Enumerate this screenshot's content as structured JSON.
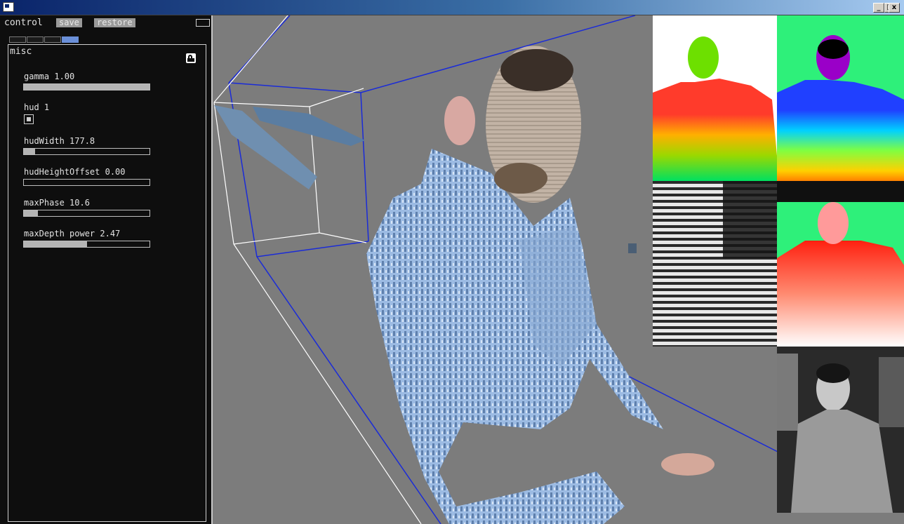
{
  "window": {
    "title": "",
    "buttons": [
      "_",
      "□",
      "x"
    ]
  },
  "control": {
    "title": "control",
    "save_label": "save",
    "restore_label": "restore",
    "tabs": 4,
    "active_tab": 4
  },
  "misc": {
    "label": "misc",
    "params": [
      {
        "label": "gamma 1.00",
        "fill": 1.0
      },
      {
        "label": "hud 1",
        "checked": true
      },
      {
        "label": "hudWidth 177.8",
        "fill": 0.09
      },
      {
        "label": "hudHeightOffset 0.00",
        "fill": 0.0
      },
      {
        "label": "maxPhase 10.6",
        "fill": 0.11
      },
      {
        "label": "maxDepth power 2.47",
        "fill": 0.5
      }
    ]
  },
  "icons": {
    "app": "app-window-icon",
    "lock": "lock-icon",
    "minimize": "minimize-icon",
    "maximize": "maximize-icon",
    "close": "close-icon"
  },
  "colors": {
    "viewport_bg": "#7c7c7c",
    "panel_bg": "#0e0e0e",
    "frustum_line": "#1a2bd8",
    "box_line": "#ffffff",
    "active_tab": "#6a8fd8"
  }
}
